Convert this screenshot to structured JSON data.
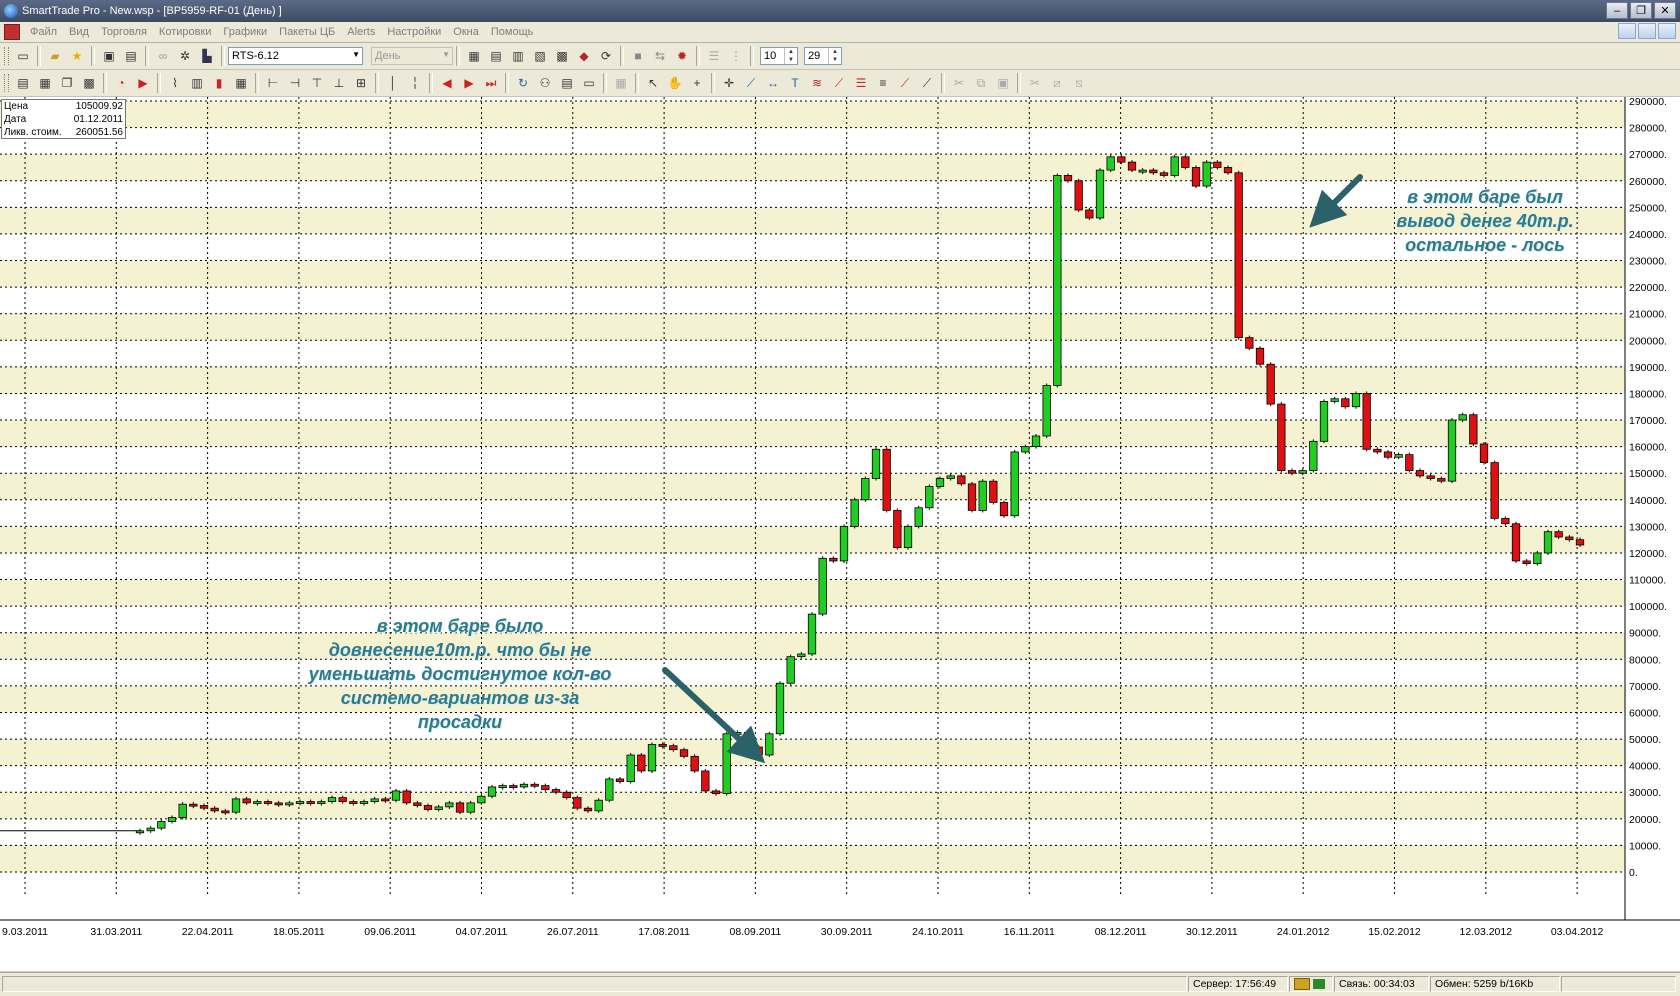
{
  "window": {
    "title": "SmartTrade Pro - New.wsp - [BP5959-RF-01 (День) ]",
    "controls": [
      "–",
      "❐",
      "✕"
    ]
  },
  "menu": [
    "Файл",
    "Вид",
    "Торговля",
    "Котировки",
    "Графики",
    "Пакеты ЦБ",
    "Alerts",
    "Настройки",
    "Окна",
    "Помощь"
  ],
  "toolbar": {
    "instrument": "RTS-6.12",
    "period": "День",
    "spin1": "10",
    "spin2": "29"
  },
  "info": {
    "rows": [
      {
        "label": "Цена",
        "value": "105009.92"
      },
      {
        "label": "Дата",
        "value": "01.12.2011"
      },
      {
        "label": "Ликв. стоим.",
        "value": "260051.56"
      }
    ]
  },
  "annotations": {
    "top_right": [
      "в этом баре был",
      "вывод денег 40т.р.",
      "остальное - лось"
    ],
    "bottom_left": [
      "в этом баре было",
      "довнесение10т.р. что бы не",
      "уменьшать достигнутое кол-во",
      "системо-вариантов из-за",
      "просадки"
    ]
  },
  "status": {
    "server": "Сервер: 17:56:49",
    "connection": "Связь: 00:34:03",
    "exchange": "Обмен: 5259 b/16Kb"
  },
  "colors": {
    "up": "#22cc22",
    "down": "#dd1111",
    "band": "#f5f2d2",
    "annotation": "#2c7a8a"
  },
  "chart_data": {
    "type": "candlestick",
    "y_tick_labels": [
      "0.",
      "10000.",
      "20000.",
      "30000.",
      "40000.",
      "50000.",
      "60000.",
      "70000.",
      "80000.",
      "90000.",
      "100000.",
      "110000.",
      "120000.",
      "130000.",
      "140000.",
      "150000.",
      "160000.",
      "170000.",
      "180000.",
      "190000.",
      "200000.",
      "210000.",
      "220000.",
      "230000.",
      "240000.",
      "250000.",
      "260000.",
      "270000.",
      "280000.",
      "290000."
    ],
    "x_tick_labels": [
      "9.03.2011",
      "31.03.2011",
      "22.04.2011",
      "18.05.2011",
      "09.06.2011",
      "04.07.2011",
      "26.07.2011",
      "17.08.2011",
      "08.09.2011",
      "30.09.2011",
      "24.10.2011",
      "16.11.2011",
      "08.12.2011",
      "30.12.2011",
      "24.01.2012",
      "15.02.2012",
      "12.03.2012",
      "03.04.2012"
    ],
    "ylim": [
      0,
      290000
    ],
    "grid": true,
    "series_closes": [
      15500,
      16500,
      19000,
      20500,
      25500,
      25000,
      24000,
      23000,
      22500,
      27500,
      26000,
      26500,
      26000,
      25500,
      26000,
      26500,
      26000,
      26500,
      28000,
      26500,
      26000,
      26500,
      27500,
      27000,
      30500,
      26000,
      25000,
      23500,
      24500,
      26000,
      22500,
      26000,
      28500,
      32000,
      32500,
      32000,
      33000,
      32500,
      31000,
      30000,
      28000,
      24000,
      23000,
      27000,
      35000,
      34000,
      44000,
      38000,
      48000,
      47500,
      46000,
      43500,
      38000,
      30500,
      29500,
      52000,
      52500,
      47000,
      44000,
      52000,
      71000,
      81000,
      82000,
      97000,
      118000,
      117000,
      130000,
      140000,
      148000,
      159000,
      136000,
      122000,
      130000,
      137000,
      145000,
      148000,
      149000,
      146000,
      136000,
      147000,
      139000,
      134000,
      158000,
      160000,
      164000,
      183000,
      262000,
      260000,
      249000,
      246000,
      264000,
      269000,
      267000,
      264000,
      264000,
      263000,
      262000,
      269000,
      265000,
      258000,
      267000,
      265000,
      263000,
      201000,
      197000,
      191000,
      176000,
      151000,
      150000,
      151000,
      162000,
      177000,
      178000,
      175000,
      180000,
      159000,
      158000,
      156000,
      157000,
      151000,
      149000,
      148000,
      147000,
      170000,
      172000,
      161000,
      154000,
      133000,
      131000,
      117000,
      116000,
      120000,
      128000,
      126000,
      125000,
      123000
    ]
  }
}
